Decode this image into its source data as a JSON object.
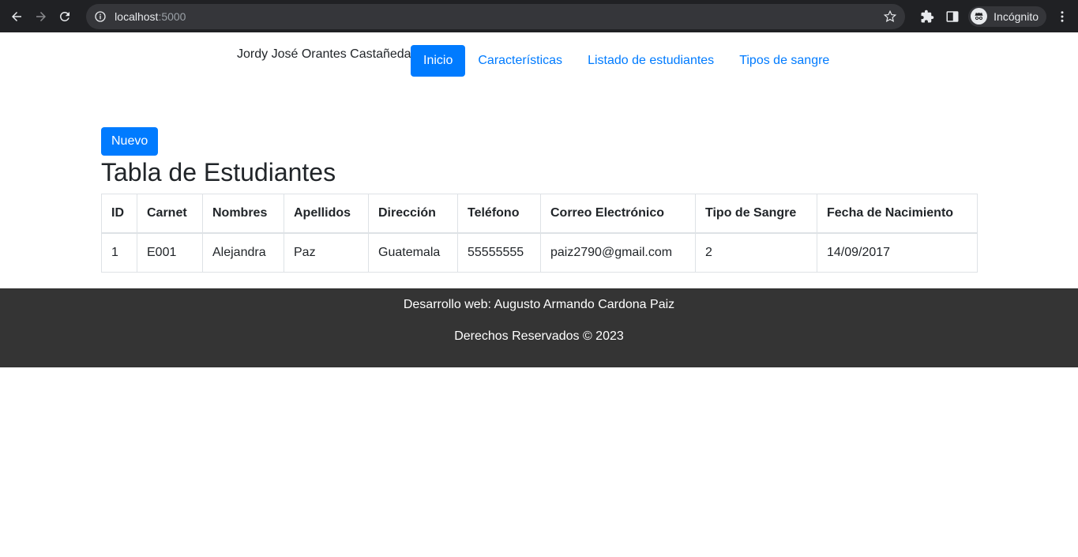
{
  "browser": {
    "url_host": "localhost",
    "url_port": ":5000",
    "profile_label": "Incógnito"
  },
  "nav": {
    "brand": "Jordy José Orantes Castañeda",
    "items": [
      {
        "label": "Inicio",
        "active": true
      },
      {
        "label": "Características",
        "active": false
      },
      {
        "label": "Listado de estudiantes",
        "active": false
      },
      {
        "label": "Tipos de sangre",
        "active": false
      }
    ]
  },
  "main": {
    "new_button": "Nuevo",
    "title": "Tabla de Estudiantes",
    "columns": [
      "ID",
      "Carnet",
      "Nombres",
      "Apellidos",
      "Dirección",
      "Teléfono",
      "Correo Electrónico",
      "Tipo de Sangre",
      "Fecha de Nacimiento"
    ],
    "rows": [
      [
        "1",
        "E001",
        "Alejandra",
        "Paz",
        "Guatemala",
        "55555555",
        "paiz2790@gmail.com",
        "2",
        "14/09/2017"
      ]
    ]
  },
  "footer": {
    "line1": "Desarrollo web: Augusto Armando Cardona Paiz",
    "line2": "Derechos Reservados © 2023"
  },
  "colors": {
    "primary": "#007bff",
    "footer_bg": "#343434",
    "chrome_bg": "#202124"
  }
}
